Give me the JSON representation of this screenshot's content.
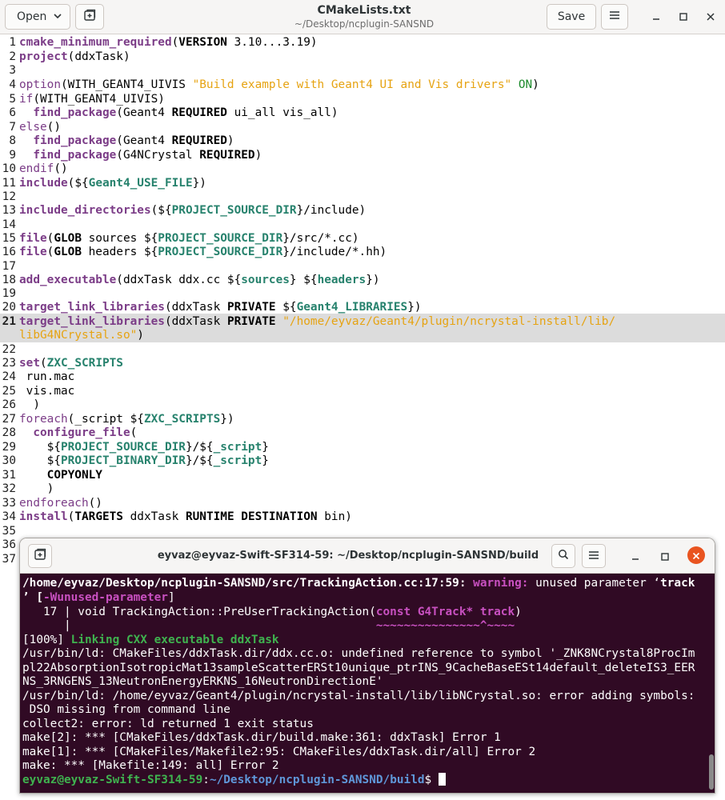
{
  "header": {
    "open_label": "Open",
    "title": "CMakeLists.txt",
    "subtitle": "~/Desktop/ncplugin-SANSND",
    "save_label": "Save"
  },
  "editor": {
    "line_numbers": [
      "1",
      "2",
      "3",
      "4",
      "5",
      "6",
      "7",
      "8",
      "9",
      "10",
      "11",
      "12",
      "13",
      "14",
      "15",
      "16",
      "17",
      "18",
      "19",
      "20",
      "21",
      "22",
      "23",
      "24",
      "25",
      "26",
      "27",
      "28",
      "29",
      "30",
      "31",
      "32",
      "33",
      "34",
      "35",
      "36",
      "37"
    ],
    "highlighted_line": "21",
    "lines": {
      "l1": {
        "kw": "cmake_minimum_required",
        "p1": "(",
        "arg": "VERSION",
        "rest": " 3.10...3.19)"
      },
      "l2": {
        "kw": "project",
        "rest": "(ddxTask)"
      },
      "l4": {
        "kw": "option",
        "p1": "(WITH_GEANT4_UIVIS ",
        "str": "\"Build example with Geant4 UI and Vis drivers\"",
        "sp": " ",
        "on": "ON",
        "rest": ")"
      },
      "l5": {
        "kw": "if",
        "rest": "(WITH_GEANT4_UIVIS)"
      },
      "l6": {
        "indent": "  ",
        "kw": "find_package",
        "p1": "(Geant4 ",
        "arg": "REQUIRED",
        "rest": " ui_all vis_all)"
      },
      "l7": {
        "kw": "else",
        "rest": "()"
      },
      "l8": {
        "indent": "  ",
        "kw": "find_package",
        "p1": "(Geant4 ",
        "arg": "REQUIRED",
        "rest": ")"
      },
      "l9": {
        "indent": "  ",
        "kw": "find_package",
        "p1": "(G4NCrystal ",
        "arg": "REQUIRED",
        "rest": ")"
      },
      "l10": {
        "kw": "endif",
        "rest": "()"
      },
      "l11": {
        "kw": "include",
        "p1": "(${",
        "var": "Geant4_USE_FILE",
        "rest": "})"
      },
      "l13": {
        "kw": "include_directories",
        "p1": "(${",
        "var": "PROJECT_SOURCE_DIR",
        "rest": "}/include)"
      },
      "l15": {
        "kw": "file",
        "p1": "(",
        "arg": "GLOB",
        "p2": " sources ${",
        "var": "PROJECT_SOURCE_DIR",
        "rest": "}/src/*.cc)"
      },
      "l16": {
        "kw": "file",
        "p1": "(",
        "arg": "GLOB",
        "p2": " headers ${",
        "var": "PROJECT_SOURCE_DIR",
        "rest": "}/include/*.hh)"
      },
      "l18": {
        "kw": "add_executable",
        "p1": "(ddxTask ddx.cc ${",
        "var": "sources",
        "p2": "} ${",
        "var2": "headers",
        "rest": "})"
      },
      "l20": {
        "kw": "target_link_libraries",
        "p1": "(ddxTask ",
        "arg": "PRIVATE",
        "p2": " ${",
        "var": "Geant4_LIBRARIES",
        "rest": "})"
      },
      "l21": {
        "kw": "target_link_libraries",
        "p1": "(ddxTask ",
        "arg": "PRIVATE",
        "sp": " ",
        "str": "\"/home/eyvaz/Geant4/plugin/ncrystal-install/lib/",
        "str2": "libG4NCrystal.so\"",
        "rest": ")"
      },
      "l23": {
        "kw": "set",
        "p1": "(",
        "var": "ZXC_SCRIPTS"
      },
      "l24": {
        "rest": " run.mac"
      },
      "l25": {
        "rest": " vis.mac"
      },
      "l26": {
        "rest": "  )"
      },
      "l27": {
        "kw": "foreach",
        "p1": "(_script ${",
        "var": "ZXC_SCRIPTS",
        "rest": "})"
      },
      "l28": {
        "indent": "  ",
        "kw": "configure_file",
        "rest": "("
      },
      "l29": {
        "indent": "    ${",
        "var": "PROJECT_SOURCE_DIR",
        "p2": "}/${",
        "var2": "_script",
        "rest": "}"
      },
      "l30": {
        "indent": "    ${",
        "var": "PROJECT_BINARY_DIR",
        "p2": "}/${",
        "var2": "_script",
        "rest": "}"
      },
      "l31": {
        "indent": "    ",
        "arg": "COPYONLY"
      },
      "l32": {
        "rest": "    )"
      },
      "l33": {
        "kw": "endforeach",
        "rest": "()"
      },
      "l34": {
        "kw": "install",
        "p1": "(",
        "arg": "TARGETS",
        "p2": " ddxTask ",
        "arg2": "RUNTIME DESTINATION",
        "rest": " bin)"
      }
    }
  },
  "terminal": {
    "title": "eyvaz@eyvaz-Swift-SF314-59: ~/Desktop/ncplugin-SANSND/build",
    "lines": {
      "t1a": "/home/eyvaz/Desktop/ncplugin-SANSND/src/TrackingAction.cc:17:59: ",
      "t1b": "warning: ",
      "t1c": "unused parameter ‘",
      "t1d": "track",
      "t2a": "’ [",
      "t2b": "-Wunused-parameter",
      "t2c": "]",
      "t3a": "   17 | void TrackingAction::PreUserTrackingAction(",
      "t3b": "const G4Track* track",
      "t3c": ")",
      "t4a": "      |                                            ",
      "t4b": "~~~~~~~~~~~~~~~^~~~~",
      "t5a": "[100%] ",
      "t5b": "Linking CXX executable ddxTask",
      "t6": "/usr/bin/ld: CMakeFiles/ddxTask.dir/ddx.cc.o: undefined reference to symbol '_ZNK8NCrystal8ProcIm",
      "t7": "pl22AbsorptionIsotropicMat13sampleScatterERSt10unique_ptrINS_9CacheBaseESt14default_deleteIS3_EER",
      "t8": "NS_3RNGENS_13NeutronEnergyERKNS_16NeutronDirectionE'",
      "t9": "/usr/bin/ld: /home/eyvaz/Geant4/plugin/ncrystal-install/lib/libNCrystal.so: error adding symbols:",
      "t10": " DSO missing from command line",
      "t11": "collect2: error: ld returned 1 exit status",
      "t12": "make[2]: *** [CMakeFiles/ddxTask.dir/build.make:361: ddxTask] Error 1",
      "t13": "make[1]: *** [CMakeFiles/Makefile2:95: CMakeFiles/ddxTask.dir/all] Error 2",
      "t14": "make: *** [Makefile:149: all] Error 2",
      "prompt_user": "eyvaz@eyvaz-Swift-SF314-59",
      "prompt_colon": ":",
      "prompt_path": "~/Desktop/ncplugin-SANSND/build",
      "prompt_sym": "$ "
    }
  },
  "colors": {
    "terminal_bg": "#300a24",
    "keyword": "#7b3c87",
    "variable": "#27826d",
    "string": "#e6a312",
    "current_line": "#dcdcdc"
  },
  "icons": [
    "chevron-down-icon",
    "new-tab-icon",
    "menu-icon",
    "minimize-icon",
    "maximize-icon",
    "close-icon",
    "search-icon"
  ]
}
